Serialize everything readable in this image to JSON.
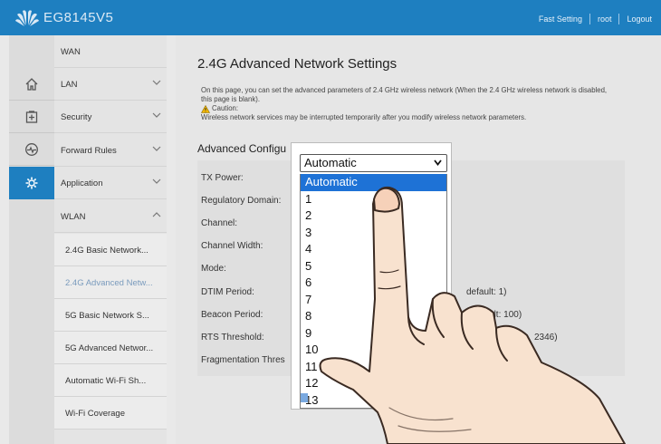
{
  "header": {
    "model": "EG8145V5",
    "links": [
      "Fast Setting",
      "root",
      "Logout"
    ]
  },
  "icon_rail": [
    {
      "icon": "home-icon"
    },
    {
      "icon": "add-box-icon"
    },
    {
      "icon": "activity-icon"
    },
    {
      "icon": "gear-icon",
      "active": true
    }
  ],
  "menu": {
    "items": [
      {
        "label": "WAN"
      },
      {
        "label": "LAN"
      },
      {
        "label": "Security"
      },
      {
        "label": "Forward Rules"
      },
      {
        "label": "Application"
      },
      {
        "label": "WLAN"
      }
    ],
    "wlan_sub": [
      {
        "label": "2.4G Basic Network..."
      },
      {
        "label": "2.4G Advanced Netw..."
      },
      {
        "label": "5G Basic Network S..."
      },
      {
        "label": "5G Advanced Networ..."
      },
      {
        "label": "Automatic Wi-Fi Sh..."
      },
      {
        "label": "Wi-Fi Coverage"
      }
    ]
  },
  "main": {
    "title": "2.4G Advanced Network Settings",
    "description": "On this page, you can set the advanced parameters of 2.4 GHz wireless network (When the 2.4 GHz wireless network is disabled, this page is blank).",
    "caution_label": "Caution:",
    "caution_text": "Wireless network services may be interrupted temporarily after you modify wireless network parameters.",
    "section_title": "Advanced Configu",
    "fields": [
      {
        "label": "TX Power:"
      },
      {
        "label": "Regulatory Domain:"
      },
      {
        "label": "Channel:"
      },
      {
        "label": "Channel Width:"
      },
      {
        "label": "Mode:"
      },
      {
        "label": "DTIM Period:"
      },
      {
        "label": "Beacon Period:"
      },
      {
        "label": "RTS Threshold:"
      },
      {
        "label": "Fragmentation Thres"
      }
    ],
    "hints": {
      "dtim": "default: 1)",
      "beacon": "s; default: 100)",
      "rts": "2346)"
    }
  },
  "dropdown": {
    "selected": "Automatic",
    "options": [
      "Automatic",
      "1",
      "2",
      "3",
      "4",
      "5",
      "6",
      "7",
      "8",
      "9",
      "10",
      "11",
      "12",
      "13"
    ]
  }
}
